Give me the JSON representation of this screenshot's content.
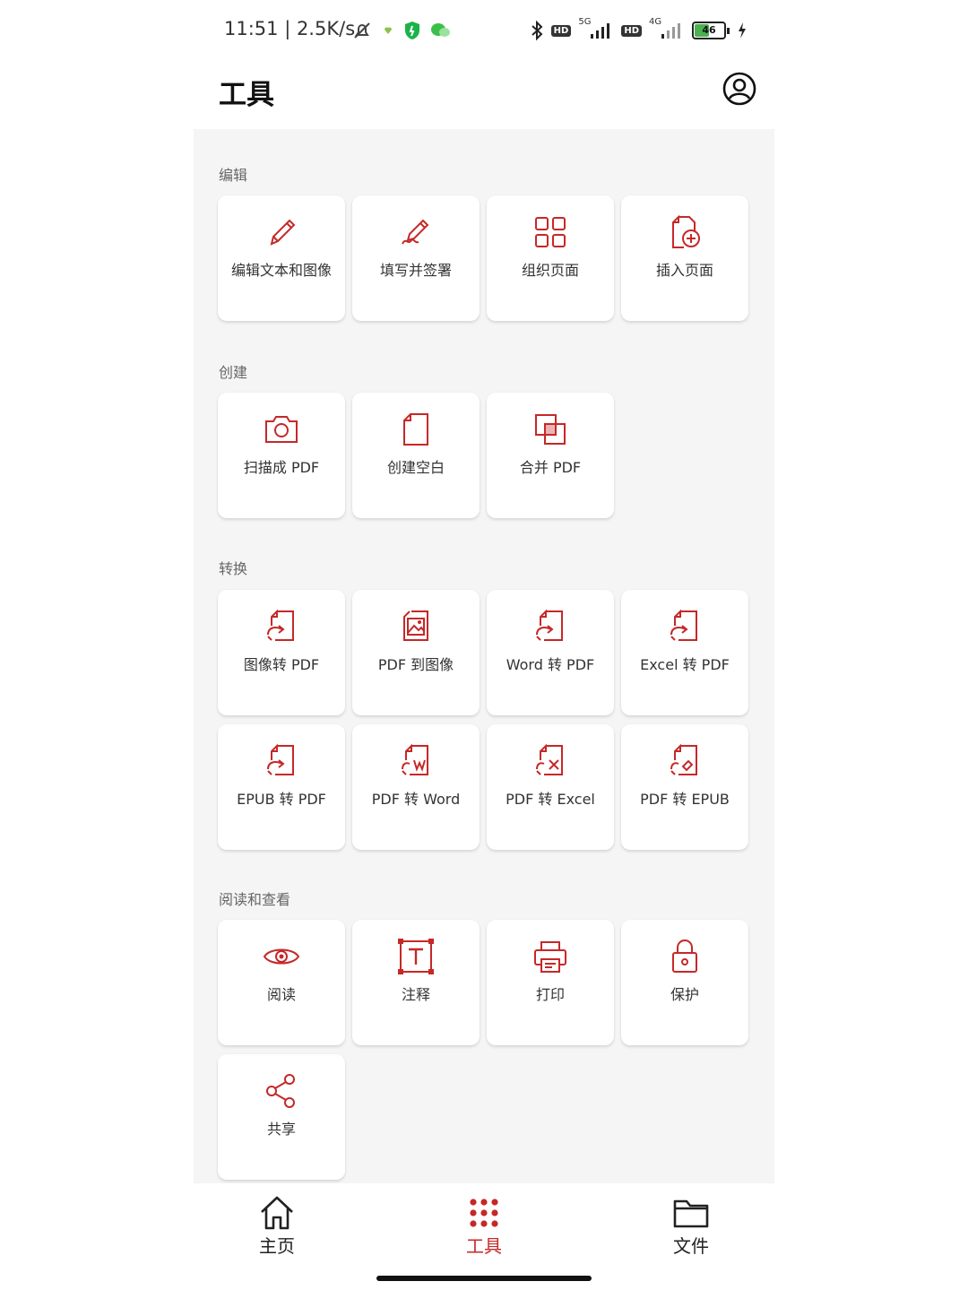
{
  "status_bar": {
    "time": "11:51 | 2.5K/s",
    "signal_5g": "5G",
    "signal_4g": "4G",
    "hd": "HD",
    "battery": "46"
  },
  "header": {
    "title": "工具"
  },
  "colors": {
    "accent": "#c62828",
    "background": "#f5f5f5"
  },
  "sections": [
    {
      "title": "编辑",
      "tiles": [
        {
          "label": "编辑文本和图像",
          "icon": "pencil-icon"
        },
        {
          "label": "填写并签署",
          "icon": "sign-pen-icon"
        },
        {
          "label": "组织页面",
          "icon": "grid-icon"
        },
        {
          "label": "插入页面",
          "icon": "insert-page-icon"
        }
      ]
    },
    {
      "title": "创建",
      "tiles": [
        {
          "label": "扫描成 PDF",
          "icon": "camera-icon"
        },
        {
          "label": "创建空白",
          "icon": "blank-page-icon"
        },
        {
          "label": "合并 PDF",
          "icon": "merge-icon"
        }
      ]
    },
    {
      "title": "转换",
      "tiles": [
        {
          "label": "图像转 PDF",
          "icon": "convert-file-icon"
        },
        {
          "label": "PDF 到图像",
          "icon": "image-file-icon"
        },
        {
          "label": "Word 转 PDF",
          "icon": "convert-file-icon"
        },
        {
          "label": "Excel 转 PDF",
          "icon": "convert-file-icon"
        },
        {
          "label": "EPUB 转 PDF",
          "icon": "convert-file-icon"
        },
        {
          "label": "PDF 转 Word",
          "icon": "word-file-icon"
        },
        {
          "label": "PDF 转 Excel",
          "icon": "excel-file-icon"
        },
        {
          "label": "PDF 转 EPUB",
          "icon": "epub-file-icon"
        }
      ]
    },
    {
      "title": "阅读和查看",
      "tiles": [
        {
          "label": "阅读",
          "icon": "eye-icon"
        },
        {
          "label": "注释",
          "icon": "text-box-icon"
        },
        {
          "label": "打印",
          "icon": "printer-icon"
        },
        {
          "label": "保护",
          "icon": "lock-icon"
        },
        {
          "label": "共享",
          "icon": "share-icon"
        }
      ]
    }
  ],
  "bottom_nav": [
    {
      "label": "主页",
      "icon": "home-icon"
    },
    {
      "label": "工具",
      "icon": "dots-grid-icon",
      "active": true
    },
    {
      "label": "文件",
      "icon": "folder-icon"
    }
  ]
}
